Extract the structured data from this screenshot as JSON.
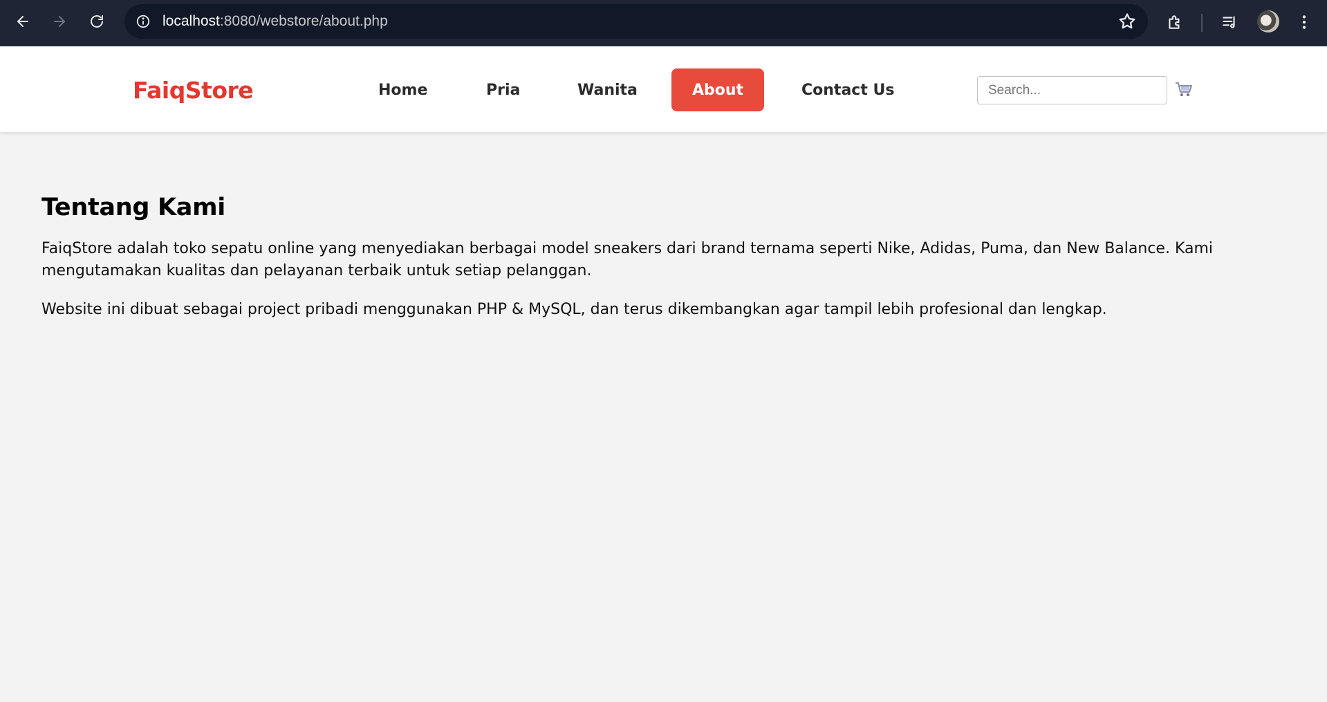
{
  "browser": {
    "url_host": "localhost",
    "url_path": ":8080/webstore/about.php",
    "icons": [
      "back-icon",
      "forward-icon",
      "reload-icon",
      "site-info-icon",
      "star-icon",
      "extensions-icon",
      "media-icon",
      "profile-avatar",
      "menu-kebab-icon"
    ]
  },
  "header": {
    "logo": "FaiqStore",
    "nav": [
      {
        "label": "Home"
      },
      {
        "label": "Pria"
      },
      {
        "label": "Wanita"
      },
      {
        "label": "About",
        "active": true
      },
      {
        "label": "Contact Us"
      }
    ],
    "search": {
      "placeholder": "Search...",
      "value": ""
    },
    "cart_icon": "cart-icon",
    "colors": {
      "brand": "#e2382f",
      "active_nav_bg": "#e84a3c"
    }
  },
  "main": {
    "title": "Tentang Kami",
    "paragraphs": [
      "FaiqStore adalah toko sepatu online yang menyediakan berbagai model sneakers dari brand ternama seperti Nike, Adidas, Puma, dan New Balance. Kami mengutamakan kualitas dan pelayanan terbaik untuk setiap pelanggan.",
      "Website ini dibuat sebagai project pribadi menggunakan PHP & MySQL, dan terus dikembangkan agar tampil lebih profesional dan lengkap."
    ]
  }
}
